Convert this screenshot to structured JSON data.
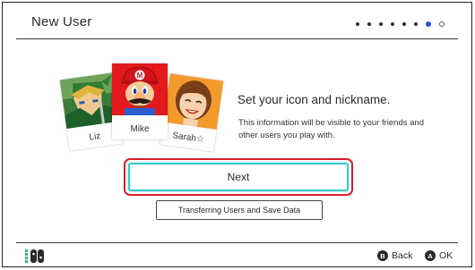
{
  "header": {
    "title": "New User",
    "progress": {
      "total_steps": 8,
      "current_step": 7
    }
  },
  "icons": [
    {
      "name": "Liz",
      "character": "Link"
    },
    {
      "name": "Mike",
      "character": "Mario"
    },
    {
      "name": "Sarah☆",
      "character": "Mii"
    }
  ],
  "main": {
    "headline": "Set your icon and nickname.",
    "description": "This information will be visible to your friends and other users you play with.",
    "next_label": "Next",
    "transfer_label": "Transferring Users and Save Data"
  },
  "footer": {
    "back_button_glyph": "B",
    "back_label": "Back",
    "ok_button_glyph": "A",
    "ok_label": "OK"
  },
  "colors": {
    "focus_outline": "#d81f2a",
    "button_highlight": "#3cc7c7",
    "progress_active": "#1f55e0"
  }
}
